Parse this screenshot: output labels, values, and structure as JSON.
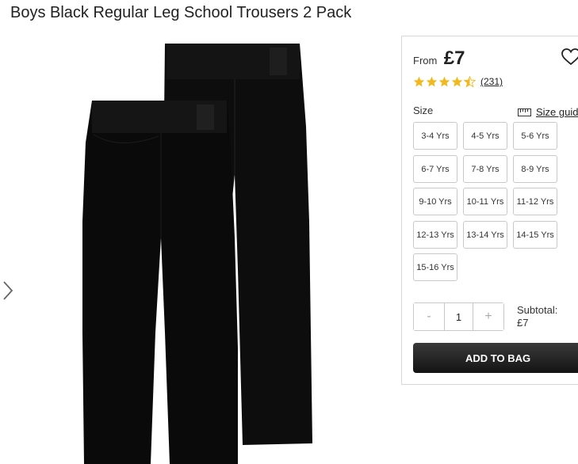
{
  "product": {
    "title": "Boys Black Regular Leg School Trousers 2 Pack",
    "image_alt": "Boys Black Regular Leg School Trousers 2 Pack"
  },
  "gallery": {
    "next_icon": "chevron-right-icon"
  },
  "purchase": {
    "from_label": "From",
    "price": "£7",
    "rating": 4.5,
    "rating_max": 5,
    "reviews_count": "(231)",
    "size_label": "Size",
    "size_guide_label": "Size guide",
    "sizes": [
      "3-4 Yrs",
      "4-5 Yrs",
      "5-6 Yrs",
      "6-7 Yrs",
      "7-8 Yrs",
      "8-9 Yrs",
      "9-10 Yrs",
      "10-11 Yrs",
      "11-12 Yrs",
      "12-13 Yrs",
      "13-14 Yrs",
      "14-15 Yrs",
      "15-16 Yrs"
    ],
    "quantity": {
      "minus_label": "-",
      "value": "1",
      "plus_label": "+"
    },
    "subtotal_label": "Subtotal:",
    "subtotal_value": "£7",
    "add_to_bag_label": "ADD TO BAG"
  },
  "colors": {
    "star": "#f5b81c",
    "button_dark": "#1a1a1a",
    "border": "#c9c9c9"
  }
}
